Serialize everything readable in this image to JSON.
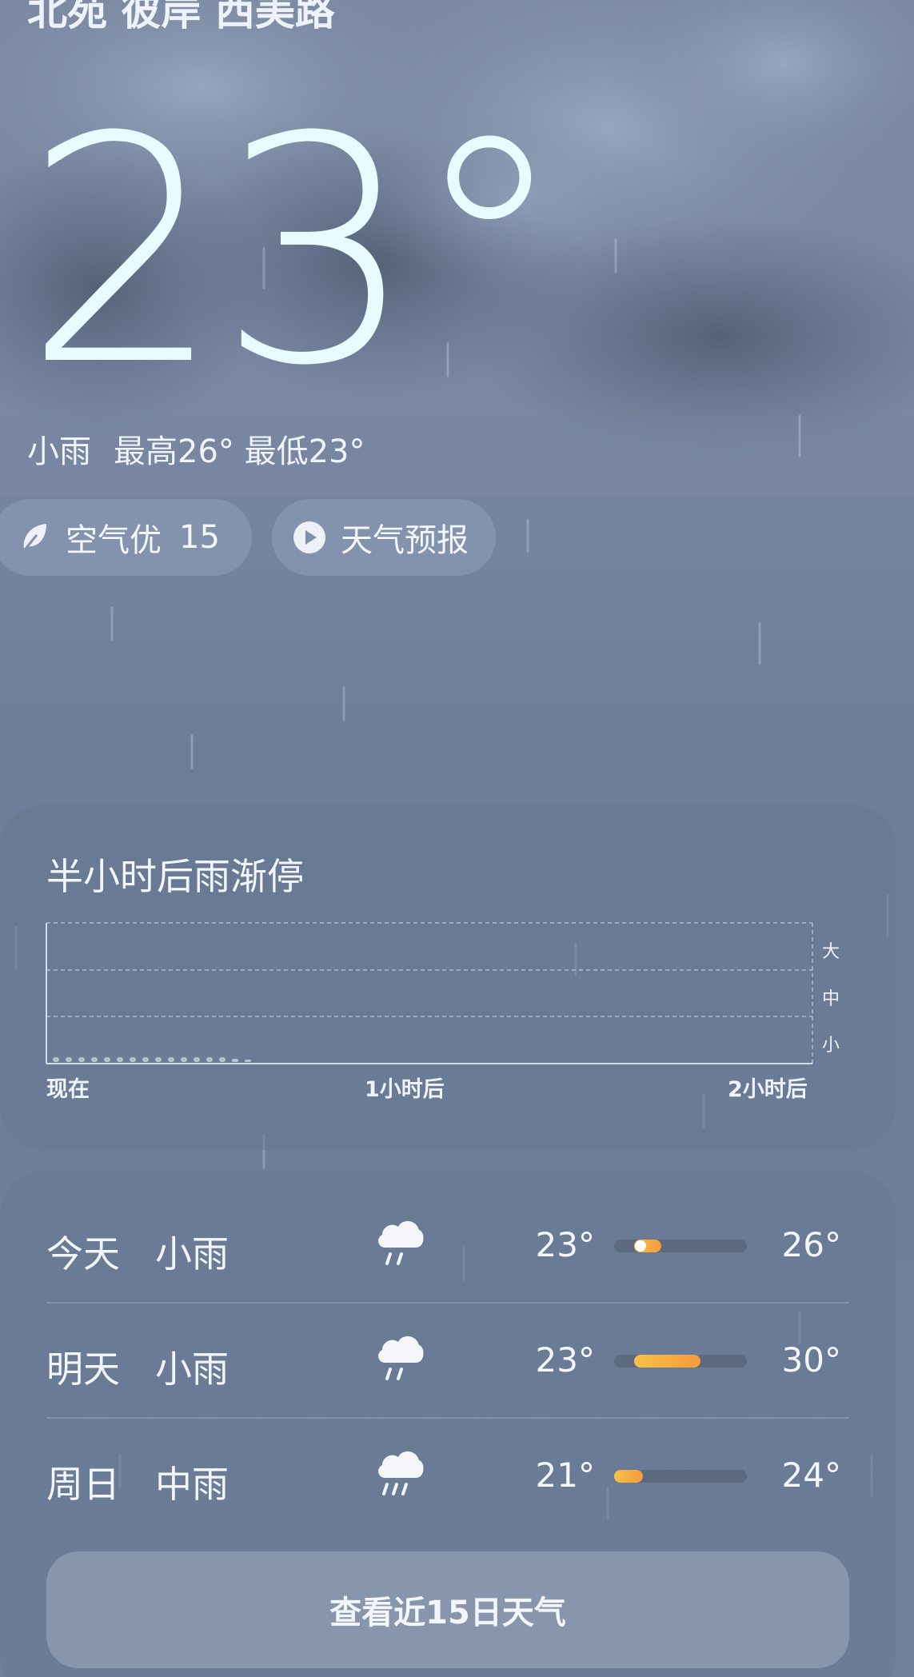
{
  "header": {
    "location": "北苑 彼岸 西美路"
  },
  "current": {
    "temperature": "23°",
    "condition": "小雨",
    "high_low": "最高26° 最低23°"
  },
  "pills": {
    "air_label": "空气优",
    "air_value": "15",
    "forecast_label": "天气预报"
  },
  "rain_card": {
    "title": "半小时后雨渐停",
    "x_labels": [
      "现在",
      "1小时后",
      "2小时后"
    ],
    "levels": [
      "大",
      "中",
      "小"
    ]
  },
  "daily": [
    {
      "day": "今天",
      "condition": "小雨",
      "icon": "light-rain-icon",
      "low": "23°",
      "high": "26°",
      "range_start": 0.15,
      "range_end": 0.35,
      "current": 0.2
    },
    {
      "day": "明天",
      "condition": "小雨",
      "icon": "light-rain-icon",
      "low": "23°",
      "high": "30°",
      "range_start": 0.15,
      "range_end": 0.65
    },
    {
      "day": "周日",
      "condition": "中雨",
      "icon": "moderate-rain-icon",
      "low": "21°",
      "high": "24°",
      "range_start": 0.0,
      "range_end": 0.22
    }
  ],
  "more_button": "查看近15日天气",
  "colors": {
    "accent_orange": "#f59a3e",
    "accent_yellow": "#f7c24a",
    "temp_text": "#e8fbff"
  }
}
